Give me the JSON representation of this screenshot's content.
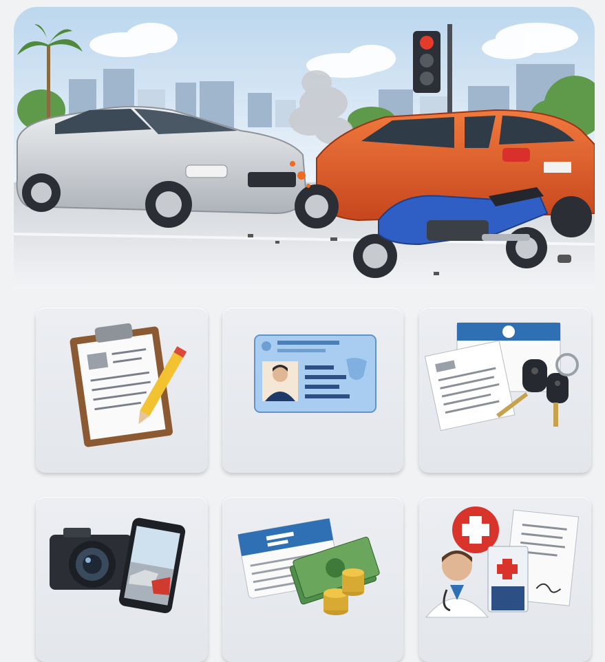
{
  "hero": {
    "icon": "car-accident-scene-icon",
    "colors": {
      "sky": "#d9e9f5",
      "silver_car": "#cfd3d8",
      "orange_car": "#e2592a",
      "motorcycle": "#2f5fc4"
    }
  },
  "cards": [
    {
      "icon": "clipboard-report-icon"
    },
    {
      "icon": "driver-license-icon"
    },
    {
      "icon": "vehicle-documents-keys-icon"
    },
    {
      "icon": "camera-phone-photos-icon"
    },
    {
      "icon": "insurance-card-money-icon"
    },
    {
      "icon": "medical-report-icon"
    }
  ]
}
